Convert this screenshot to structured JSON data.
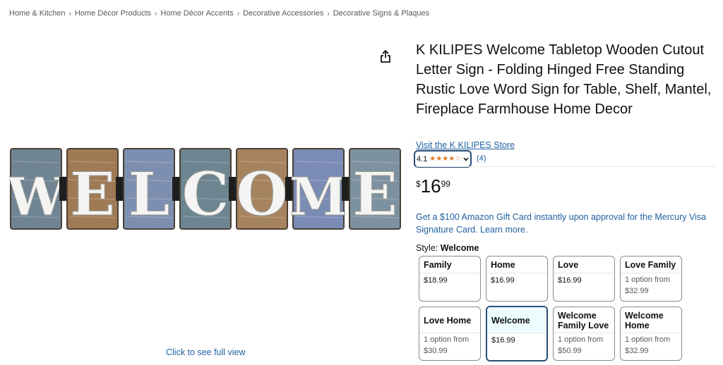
{
  "breadcrumb": [
    "Home & Kitchen",
    "Home Décor Products",
    "Home Décor Accents",
    "Decorative Accessories",
    "Decorative Signs & Plaques"
  ],
  "breadcrumb_sep": "›",
  "image": {
    "letters": [
      "W",
      "E",
      "L",
      "C",
      "O",
      "M",
      "E"
    ],
    "panel_colors": [
      "#6f8593",
      "#a07a55",
      "#7d8fb0",
      "#6d8590",
      "#a6835f",
      "#7a8cb4",
      "#7d92a0"
    ],
    "full_view_label": "Click to see full view"
  },
  "icons": {
    "share": "share-icon"
  },
  "product": {
    "title": "K KILIPES Welcome Tabletop Wooden Cutout Letter Sign - Folding Hinged Free Standing Rustic Love Word Sign for Table, Shelf, Mantel, Fireplace Farmhouse Home Decor",
    "store_link": "Visit the K KILIPES Store",
    "rating": "4.1",
    "stars_filled": 4,
    "stars_total": 5,
    "review_count": "(4)",
    "price_symbol": "$",
    "price_whole": "16",
    "price_fraction": "99",
    "promo": "Get a $100 Amazon Gift Card instantly upon approval for the Mercury Visa Signature Card. Learn more."
  },
  "style": {
    "label": "Style:",
    "selected": "Welcome",
    "options": [
      {
        "name": "Family",
        "price": "$18.99",
        "note": ""
      },
      {
        "name": "Home",
        "price": "$16.99",
        "note": ""
      },
      {
        "name": "Love",
        "price": "$16.99",
        "note": ""
      },
      {
        "name": "Love Family",
        "price": "$32.99",
        "note": "1 option from"
      },
      {
        "name": "Love Home",
        "price": "$30.99",
        "note": "1 option from"
      },
      {
        "name": "Welcome",
        "price": "$16.99",
        "note": ""
      },
      {
        "name": "Welcome Family Love",
        "price": "$50.99",
        "note": "1 option from"
      },
      {
        "name": "Welcome Home",
        "price": "$32.99",
        "note": "1 option from"
      }
    ]
  },
  "colors": {
    "link": "#2162a1",
    "star": "#de7921",
    "selected_border": "#2b4d78"
  }
}
